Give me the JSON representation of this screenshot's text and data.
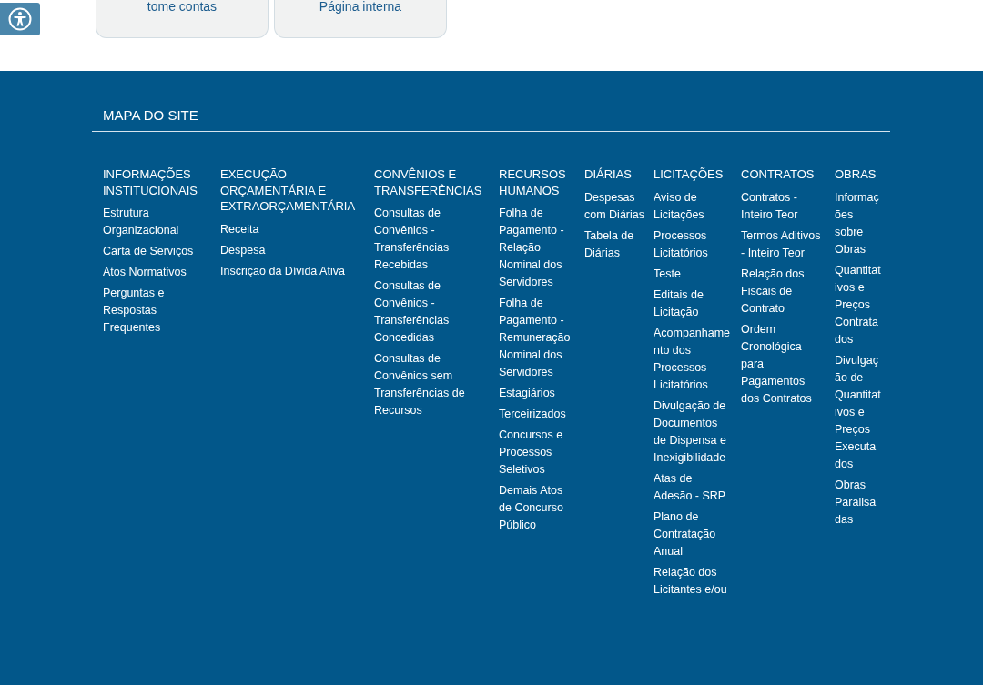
{
  "cards": [
    {
      "label": "tome contas"
    },
    {
      "label": "Página interna"
    }
  ],
  "footer": {
    "title": "MAPA DO SITE",
    "columns": [
      {
        "heading": "INFORMAÇÕES INSTITUCIONAIS",
        "links": [
          "Estrutura Organizacional",
          "Carta de Serviços",
          "Atos Normativos",
          "Perguntas e Respostas Frequentes"
        ]
      },
      {
        "heading": "EXECUÇÃO ORÇAMENTÁRIA E EXTRAORÇAMENTÁRIA",
        "links": [
          "Receita",
          "Despesa",
          "Inscrição da Dívida Ativa"
        ]
      },
      {
        "heading": "CONVÊNIOS E TRANSFERÊNCIAS",
        "links": [
          "Consultas de Convênios - Transferências Recebidas",
          "Consultas de Convênios - Transferências Concedidas",
          "Consultas de Convênios sem Transferências de Recursos"
        ]
      },
      {
        "heading": "RECURSOS HUMANOS",
        "links": [
          "Folha de Pagamento - Relação Nominal dos Servidores",
          "Folha de Pagamento - Remuneração Nominal dos Servidores",
          "Estagiários",
          "Terceirizados",
          "Concursos e Processos Seletivos",
          "Demais Atos de Concurso Público"
        ]
      },
      {
        "heading": "DIÁRIAS",
        "links": [
          "Despesas com Diárias",
          "Tabela de Diárias"
        ]
      },
      {
        "heading": "LICITAÇÕES",
        "links": [
          "Aviso de Licitações",
          "Processos Licitatórios",
          "Teste",
          "Editais de Licitação",
          "Acompanhamento dos Processos Licitatórios",
          "Divulgação de Documentos de Dispensa e Inexigibilidade",
          "Atas de Adesão - SRP",
          "Plano de Contratação Anual",
          "Relação dos Licitantes e/ou"
        ]
      },
      {
        "heading": "CONTRATOS",
        "links": [
          "Contratos - Inteiro Teor",
          "Termos Aditivos - Inteiro Teor",
          "Relação dos Fiscais de Contrato",
          "Ordem Cronológica para Pagamentos dos Contratos"
        ]
      },
      {
        "heading": "OBRAS",
        "links": [
          "Informações sobre Obras",
          "Quantitativos e Preços Contratados",
          "Divulgação de Quantitativos e Preços Executados",
          "Obras Paralisadas"
        ]
      }
    ]
  }
}
